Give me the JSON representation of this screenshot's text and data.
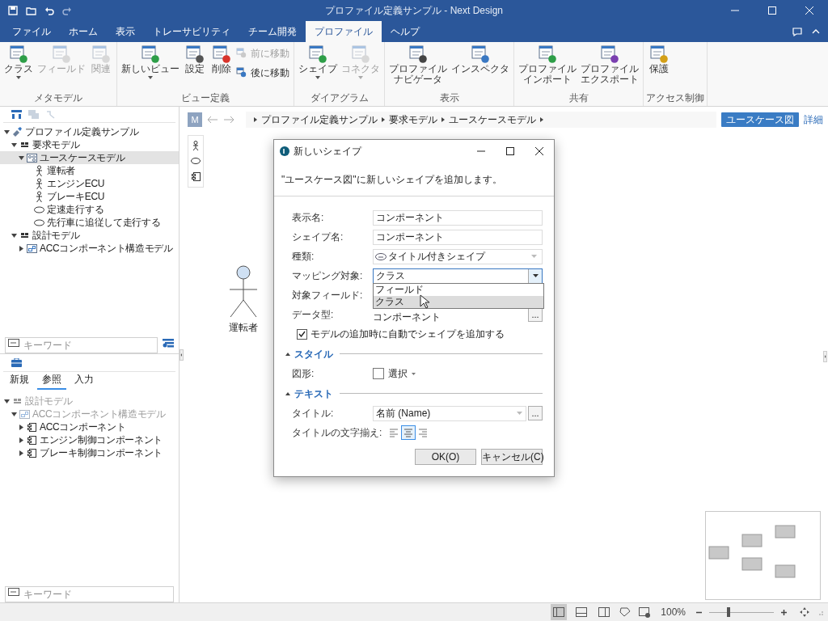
{
  "window": {
    "title": "プロファイル定義サンプル - Next Design"
  },
  "ribbon": {
    "tabs": [
      {
        "label": "ファイル",
        "selected": false
      },
      {
        "label": "ホーム",
        "selected": false
      },
      {
        "label": "表示",
        "selected": false
      },
      {
        "label": "トレーサビリティ",
        "selected": false
      },
      {
        "label": "チーム開発",
        "selected": false
      },
      {
        "label": "プロファイル",
        "selected": true
      },
      {
        "label": "ヘルプ",
        "selected": false
      }
    ],
    "groups": [
      {
        "label": "メタモデル",
        "buttons": [
          {
            "kind": "large",
            "lines": [
              "クラス"
            ],
            "disabled": false,
            "dropdown": true
          },
          {
            "kind": "large",
            "lines": [
              "フィールド"
            ],
            "disabled": true,
            "dropdown": false
          },
          {
            "kind": "large",
            "lines": [
              "関連"
            ],
            "disabled": true,
            "dropdown": false
          }
        ]
      },
      {
        "label": "ビュー定義",
        "buttons": [
          {
            "kind": "large",
            "lines": [
              "新しいビュー"
            ],
            "disabled": false,
            "dropdown": true
          },
          {
            "kind": "large",
            "lines": [
              "設定"
            ],
            "disabled": false,
            "dropdown": false
          },
          {
            "kind": "large",
            "lines": [
              "削除"
            ],
            "disabled": false,
            "dropdown": false
          },
          {
            "kind": "small",
            "lines": [
              "前に移動"
            ],
            "disabled": true
          },
          {
            "kind": "small",
            "lines": [
              "後に移動"
            ],
            "disabled": false
          }
        ]
      },
      {
        "label": "ダイアグラム",
        "buttons": [
          {
            "kind": "large",
            "lines": [
              "シェイプ"
            ],
            "disabled": false,
            "dropdown": true
          },
          {
            "kind": "large",
            "lines": [
              "コネクタ"
            ],
            "disabled": true,
            "dropdown": true
          }
        ]
      },
      {
        "label": "表示",
        "buttons": [
          {
            "kind": "large",
            "lines": [
              "プロファイル",
              "ナビゲータ"
            ],
            "disabled": false,
            "dropdown": false
          },
          {
            "kind": "large",
            "lines": [
              "インスペクタ"
            ],
            "disabled": false,
            "dropdown": false
          }
        ]
      },
      {
        "label": "共有",
        "buttons": [
          {
            "kind": "large",
            "lines": [
              "プロファイル",
              "インポート"
            ],
            "disabled": false,
            "dropdown": false
          },
          {
            "kind": "large",
            "lines": [
              "プロファイル",
              "エクスポート"
            ],
            "disabled": false,
            "dropdown": false
          }
        ]
      },
      {
        "label": "アクセス制御",
        "buttons": [
          {
            "kind": "large",
            "lines": [
              "保護"
            ],
            "disabled": false,
            "dropdown": false
          }
        ]
      }
    ]
  },
  "explorer": {
    "tree": [
      {
        "label": "プロファイル定義サンプル",
        "kind": "project",
        "expanded": true,
        "selected": false,
        "disabled": false,
        "children": [
          {
            "label": "要求モデル",
            "kind": "package",
            "expanded": true,
            "selected": false,
            "disabled": false,
            "children": [
              {
                "label": "ユースケースモデル",
                "kind": "model",
                "expanded": true,
                "selected": true,
                "disabled": false,
                "children": [
                  {
                    "label": "運転者",
                    "kind": "actor",
                    "selected": false,
                    "disabled": false
                  },
                  {
                    "label": "エンジンECU",
                    "kind": "actor",
                    "selected": false,
                    "disabled": false
                  },
                  {
                    "label": "ブレーキECU",
                    "kind": "actor",
                    "selected": false,
                    "disabled": false
                  },
                  {
                    "label": "定速走行する",
                    "kind": "usecase",
                    "selected": false,
                    "disabled": false
                  },
                  {
                    "label": "先行車に追従して走行する",
                    "kind": "usecase",
                    "selected": false,
                    "disabled": false
                  }
                ]
              }
            ]
          },
          {
            "label": "設計モデル",
            "kind": "package",
            "expanded": true,
            "selected": false,
            "disabled": false,
            "children": [
              {
                "label": "ACCコンポーネント構造モデル",
                "kind": "structure",
                "expanded": false,
                "selected": false,
                "disabled": false
              }
            ]
          }
        ]
      }
    ],
    "search": {
      "placeholder": "キーワード"
    }
  },
  "reference_panel": {
    "tabs": [
      {
        "label": "新規",
        "selected": false
      },
      {
        "label": "参照",
        "selected": true
      },
      {
        "label": "入力",
        "selected": false
      }
    ],
    "tree": [
      {
        "label": "設計モデル",
        "kind": "package",
        "expanded": true,
        "selected": false,
        "disabled": true,
        "children": [
          {
            "label": "ACCコンポーネント構造モデル",
            "kind": "structure",
            "expanded": true,
            "selected": false,
            "disabled": true,
            "children": [
              {
                "label": "ACCコンポーネント",
                "kind": "component",
                "expanded": false,
                "selected": false,
                "disabled": false
              },
              {
                "label": "エンジン制御コンポーネント",
                "kind": "component",
                "expanded": false,
                "selected": false,
                "disabled": false
              },
              {
                "label": "ブレーキ制御コンポーネント",
                "kind": "component",
                "expanded": false,
                "selected": false,
                "disabled": false
              }
            ]
          }
        ]
      }
    ],
    "search": {
      "placeholder": "キーワード"
    }
  },
  "editor": {
    "mode_button": "M",
    "breadcrumb": [
      "プロファイル定義サンプル",
      "要求モデル",
      "ユースケースモデル"
    ],
    "view_button": "ユースケース図",
    "detail_link": "詳細",
    "palette": [
      {
        "kind": "actor"
      },
      {
        "kind": "usecase"
      },
      {
        "kind": "component"
      }
    ],
    "shapes": [
      {
        "kind": "actor",
        "label": "運転者"
      }
    ]
  },
  "dialog": {
    "title": "新しいシェイプ",
    "message": "\"ユースケース図\"に新しいシェイプを追加します。",
    "fields": [
      {
        "kind": "text",
        "label": "表示名:",
        "value": "コンポーネント"
      },
      {
        "kind": "text",
        "label": "シェイプ名:",
        "value": "コンポーネント"
      },
      {
        "kind": "combo",
        "label": "種類:",
        "value": "タイトル付きシェイプ"
      },
      {
        "kind": "dropdown",
        "label": "マッピング対象:",
        "value": "クラス",
        "expanded": true,
        "options": [
          {
            "label": "フィールド",
            "selected": false
          },
          {
            "label": "クラス",
            "selected": true
          }
        ]
      },
      {
        "kind": "covered",
        "label": "対象フィールド:"
      },
      {
        "kind": "browse",
        "label": "データ型:",
        "value": "コンポーネント",
        "button": "..."
      }
    ],
    "auto_add": {
      "label": "モデルの追加時に自動でシェイプを追加する",
      "checked": true
    },
    "sections": [
      {
        "title": "スタイル",
        "expanded": true,
        "rows": [
          {
            "kind": "shape_picker",
            "label": "図形:",
            "value": "選択"
          }
        ]
      },
      {
        "title": "テキスト",
        "expanded": true,
        "rows": [
          {
            "kind": "combo_browse",
            "label": "タイトル:",
            "value": "名前 (Name)",
            "button": "..."
          },
          {
            "kind": "align",
            "label": "タイトルの文字揃え:",
            "options": [
              {
                "selected": false
              },
              {
                "selected": true
              },
              {
                "selected": false
              }
            ]
          }
        ]
      }
    ],
    "buttons": [
      "OK(O)",
      "キャンセル(C)"
    ]
  },
  "status_bar": {
    "views": [
      {
        "selected": true
      },
      {
        "selected": false
      },
      {
        "selected": false
      }
    ],
    "zoom": "100%",
    "zoom_slider": {
      "level": 0.3
    }
  }
}
